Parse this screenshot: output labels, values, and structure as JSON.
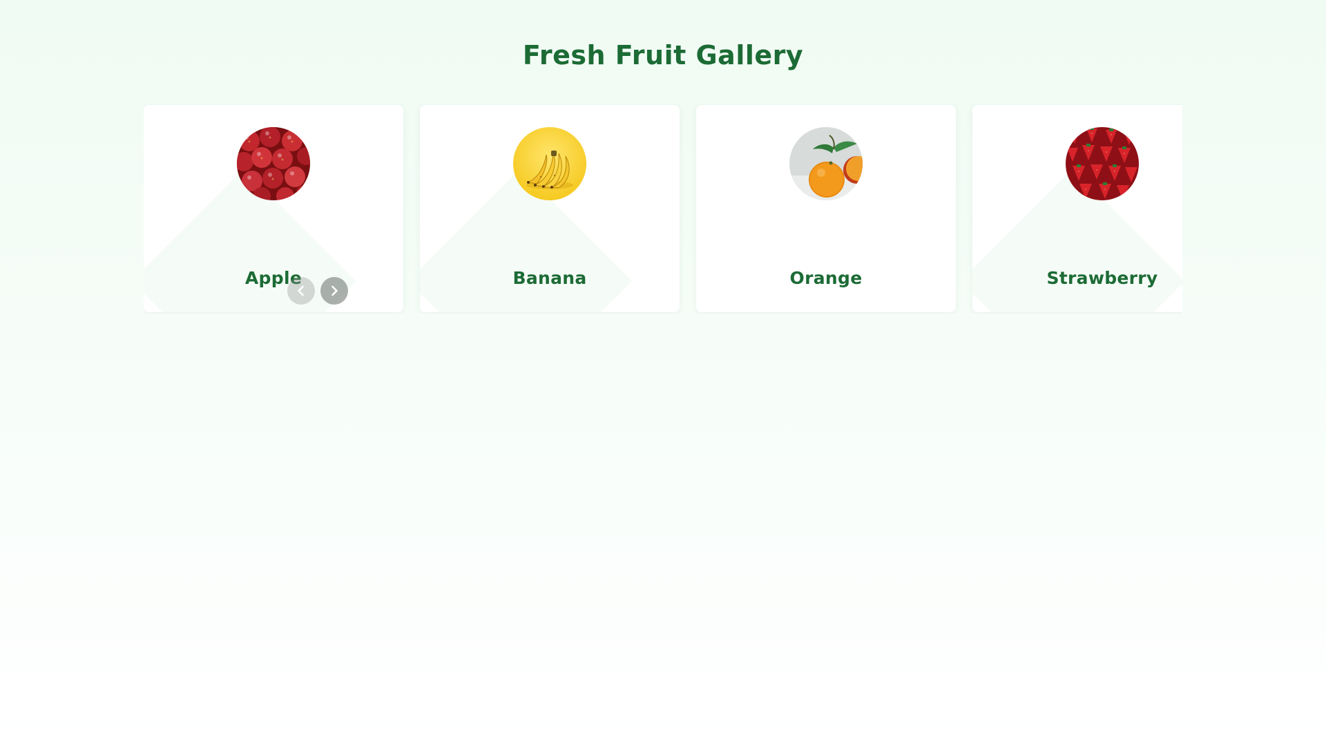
{
  "page": {
    "title": "Fresh Fruit Gallery"
  },
  "colors": {
    "title": "#1c6b35",
    "label": "#1c6b35",
    "card_background": "#ffffff",
    "page_background_top": "#f0fbf3",
    "page_background_bottom": "#ffffff"
  },
  "carousel": {
    "cards": [
      {
        "label": "Apple",
        "image_icon": "apple-icon"
      },
      {
        "label": "Banana",
        "image_icon": "banana-icon"
      },
      {
        "label": "Orange",
        "image_icon": "orange-icon"
      },
      {
        "label": "Strawberry",
        "image_icon": "strawberry-icon"
      }
    ],
    "controls": {
      "prev_icon": "chevron-left-icon",
      "next_icon": "chevron-right-icon"
    }
  }
}
